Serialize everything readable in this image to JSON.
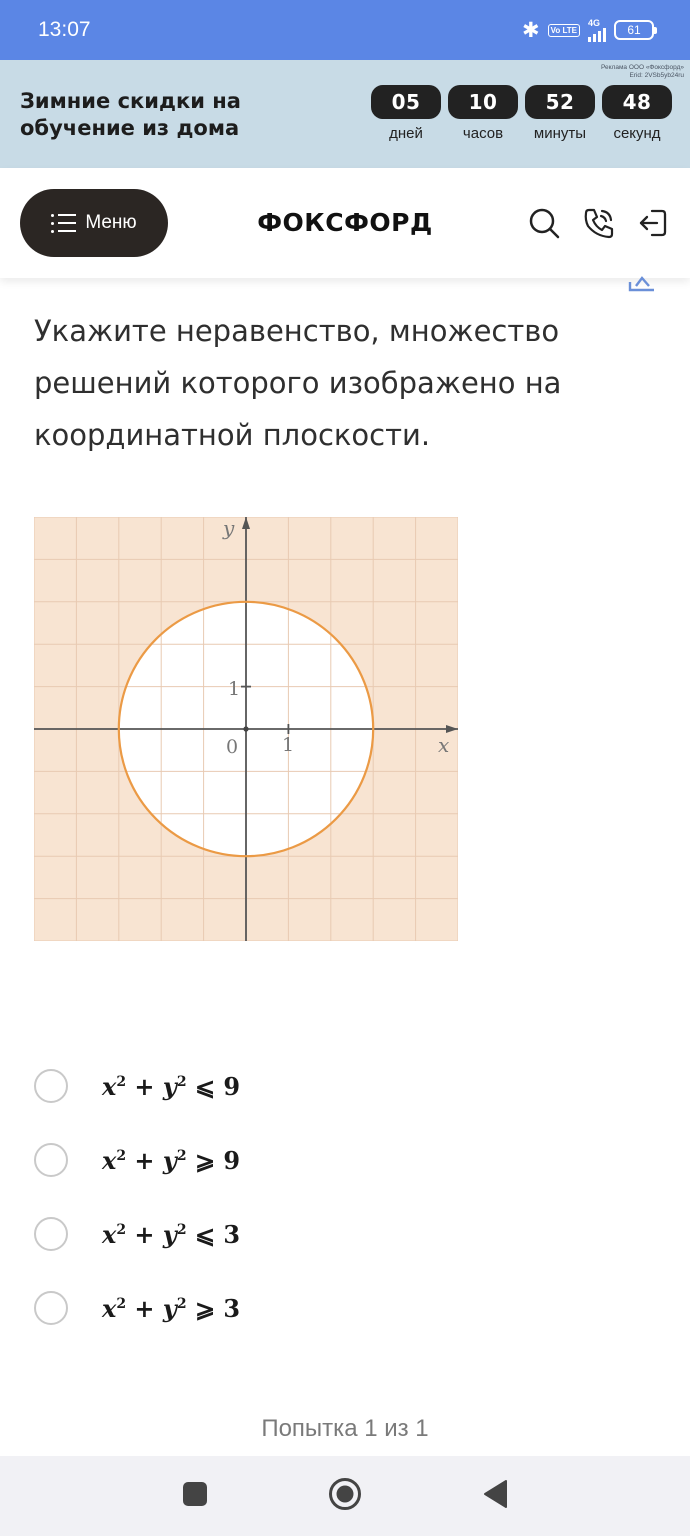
{
  "status_bar": {
    "time": "13:07",
    "bluetooth_icon": "bluetooth-icon",
    "volte_text": "Vo LTE",
    "network_text": "4G",
    "battery": "61"
  },
  "promo": {
    "ad_note_line1": "Реклама ООО «Фоксфорд»",
    "ad_note_line2": "Erid: 2VSb5yb24ru",
    "title": "Зимние скидки на обучение из дома",
    "timer": [
      {
        "value": "05",
        "label": "дней"
      },
      {
        "value": "10",
        "label": "часов"
      },
      {
        "value": "52",
        "label": "минуты"
      },
      {
        "value": "48",
        "label": "секунд"
      }
    ]
  },
  "nav": {
    "menu_label": "Меню",
    "logo": "ФОКСФОРД",
    "icons": [
      "search-icon",
      "phone-icon",
      "login-icon"
    ]
  },
  "question": {
    "text": "Укажите неравенство, множество решений которого изображено на координатной плоскости."
  },
  "graph": {
    "x_label": "x",
    "y_label": "y",
    "origin_label": "0",
    "x_tick_label": "1",
    "y_tick_label": "1",
    "x_range": [
      -5,
      5
    ],
    "y_range": [
      -5,
      5
    ],
    "circle_radius": 3,
    "shaded_region": "outside",
    "colors": {
      "fill": "#f8e4d2",
      "grid": "#e8cab2",
      "circle": "#eb9a45",
      "axis": "#555555"
    }
  },
  "options": [
    {
      "base_a": "x",
      "exp": "2",
      "op_plus": "+",
      "base_b": "y",
      "relation": "⩽",
      "value": "9"
    },
    {
      "base_a": "x",
      "exp": "2",
      "op_plus": "+",
      "base_b": "y",
      "relation": "⩾",
      "value": "9"
    },
    {
      "base_a": "x",
      "exp": "2",
      "op_plus": "+",
      "base_b": "y",
      "relation": "⩽",
      "value": "3"
    },
    {
      "base_a": "x",
      "exp": "2",
      "op_plus": "+",
      "base_b": "y",
      "relation": "⩾",
      "value": "3"
    }
  ],
  "footer": {
    "attempt": "Попытка 1 из 1"
  }
}
